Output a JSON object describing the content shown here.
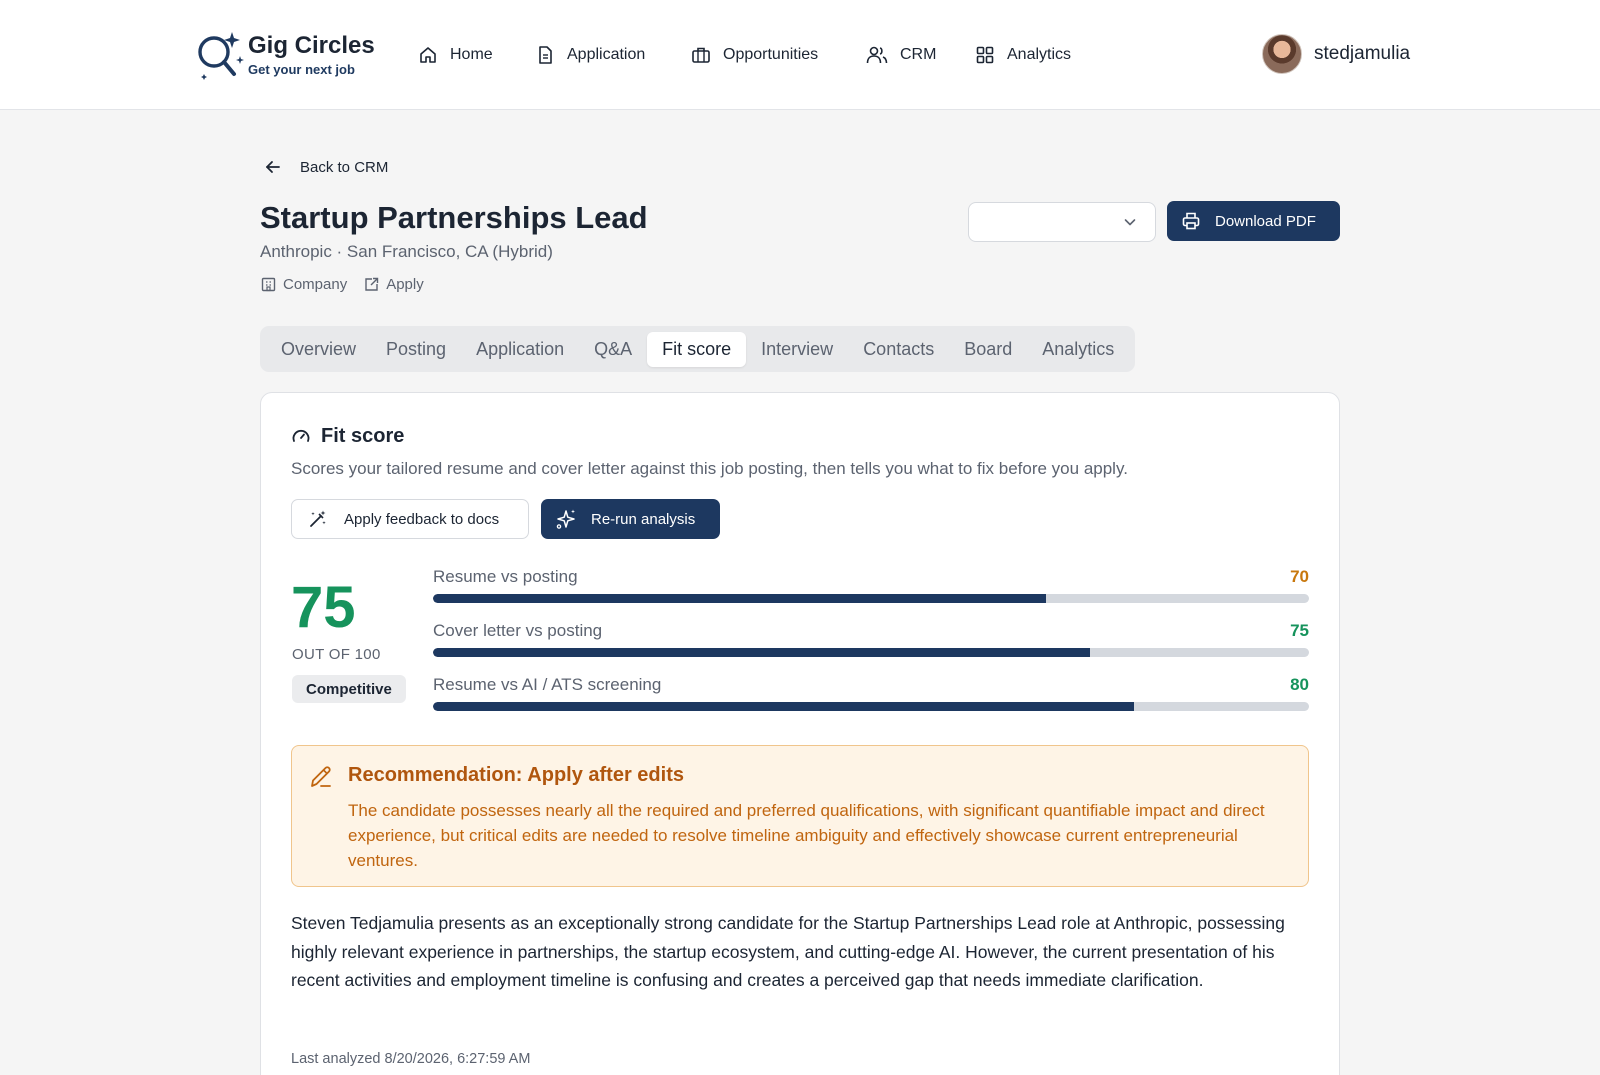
{
  "brand": {
    "name": "Gig Circles",
    "tagline": "Get your next job"
  },
  "nav": {
    "items": [
      {
        "label": "Home",
        "icon": "home-icon"
      },
      {
        "label": "Application",
        "icon": "document-icon"
      },
      {
        "label": "Opportunities",
        "icon": "briefcase-icon"
      },
      {
        "label": "CRM",
        "icon": "users-icon"
      },
      {
        "label": "Analytics",
        "icon": "grid-icon"
      }
    ]
  },
  "user": {
    "name": "stedjamulia"
  },
  "page": {
    "back_label": "Back to CRM",
    "title": "Startup Partnerships Lead",
    "subtitle": "Anthropic · San Francisco, CA (Hybrid)",
    "links": {
      "company": "Company",
      "apply": "Apply"
    },
    "select_value": "",
    "download_label": "Download PDF"
  },
  "tabs": [
    {
      "label": "Overview",
      "active": false
    },
    {
      "label": "Posting",
      "active": false
    },
    {
      "label": "Application",
      "active": false
    },
    {
      "label": "Q&A",
      "active": false
    },
    {
      "label": "Fit score",
      "active": true
    },
    {
      "label": "Interview",
      "active": false
    },
    {
      "label": "Contacts",
      "active": false
    },
    {
      "label": "Board",
      "active": false
    },
    {
      "label": "Analytics",
      "active": false
    }
  ],
  "fit": {
    "title": "Fit score",
    "description": "Scores your tailored resume and cover letter against this job posting, then tells you what to fix before you apply.",
    "apply_feedback_label": "Apply feedback to docs",
    "rerun_label": "Re-run analysis",
    "score": "75",
    "out_of": "OUT OF 100",
    "badge": "Competitive",
    "metrics": [
      {
        "label": "Resume vs posting",
        "value": 70,
        "value_text": "70",
        "color": "#c8780e"
      },
      {
        "label": "Cover letter vs posting",
        "value": 75,
        "value_text": "75",
        "color": "#16935c"
      },
      {
        "label": "Resume vs AI / ATS screening",
        "value": 80,
        "value_text": "80",
        "color": "#16935c"
      }
    ],
    "recommendation": {
      "title": "Recommendation: Apply after edits",
      "body": "The candidate possesses nearly all the required and preferred qualifications, with significant quantifiable impact and direct experience, but critical edits are needed to resolve timeline ambiguity and effectively showcase current entrepreneurial ventures."
    },
    "summary": "Steven Tedjamulia presents as an exceptionally strong candidate for the Startup Partnerships Lead role at Anthropic, possessing highly relevant experience in partnerships, the startup ecosystem, and cutting-edge AI. However, the current presentation of his recent activities and employment timeline is confusing and creates a perceived gap that needs immediate clarification.",
    "last_analyzed": "Last analyzed 8/20/2026, 6:27:59 AM"
  },
  "colors": {
    "accent": "#1d3860",
    "score_green": "#16935c",
    "warning_orange": "#c0650f"
  }
}
